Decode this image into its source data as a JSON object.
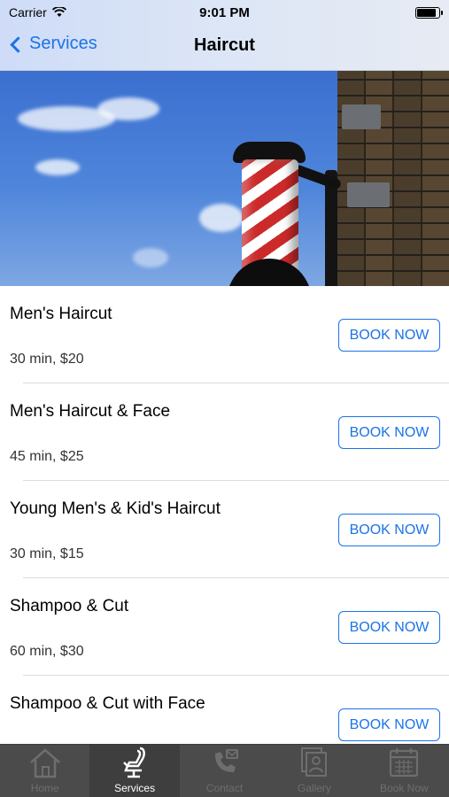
{
  "status_bar": {
    "carrier": "Carrier",
    "time": "9:01 PM",
    "battery_level": 0.8
  },
  "nav": {
    "back_label": "Services",
    "title": "Haircut"
  },
  "services": [
    {
      "name": "Men's Haircut",
      "meta": "30 min, $20",
      "button": "BOOK NOW"
    },
    {
      "name": "Men's Haircut & Face",
      "meta": "45 min, $25",
      "button": "BOOK NOW"
    },
    {
      "name": "Young Men's & Kid's Haircut",
      "meta": "30 min, $15",
      "button": "BOOK NOW"
    },
    {
      "name": "Shampoo & Cut",
      "meta": "60 min, $30",
      "button": "BOOK NOW"
    },
    {
      "name": "Shampoo & Cut with Face",
      "meta": "",
      "button": "BOOK NOW"
    }
  ],
  "tabs": [
    {
      "label": "Home",
      "icon": "home-icon"
    },
    {
      "label": "Services",
      "icon": "barber-chair-icon"
    },
    {
      "label": "Contact",
      "icon": "phone-contact-icon"
    },
    {
      "label": "Gallery",
      "icon": "gallery-icon"
    },
    {
      "label": "Book Now",
      "icon": "calendar-icon"
    }
  ],
  "colors": {
    "accent": "#1a73e8",
    "tabbar": "#4b4b4b",
    "tab_active": "#3e3e3e"
  }
}
